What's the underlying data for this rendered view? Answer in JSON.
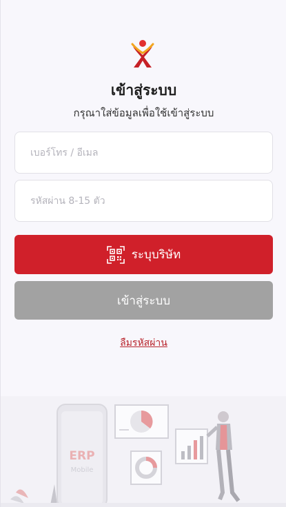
{
  "header": {
    "title": "เข้าสู่ระบบ",
    "subtitle": "กรุณาใส่ข้อมูลเพื่อใช้เข้าสู่ระบบ"
  },
  "form": {
    "username_placeholder": "เบอร์โทร / อีเมล",
    "username_value": "",
    "password_placeholder": "รหัสผ่าน 8-15 ตัว",
    "password_value": ""
  },
  "buttons": {
    "company_label": "ระบุบริษัท",
    "login_label": "เข้าสู่ระบบ",
    "forgot_label": "ลืมรหัสผ่าน"
  },
  "illustration": {
    "phone_title": "ERP",
    "phone_subtitle": "Mobile"
  },
  "colors": {
    "primary": "#d0202a",
    "disabled": "#a2a2a2",
    "link": "#b8232b"
  },
  "icons": {
    "logo": "brand-logo-icon",
    "company_button": "qr-code-icon"
  }
}
